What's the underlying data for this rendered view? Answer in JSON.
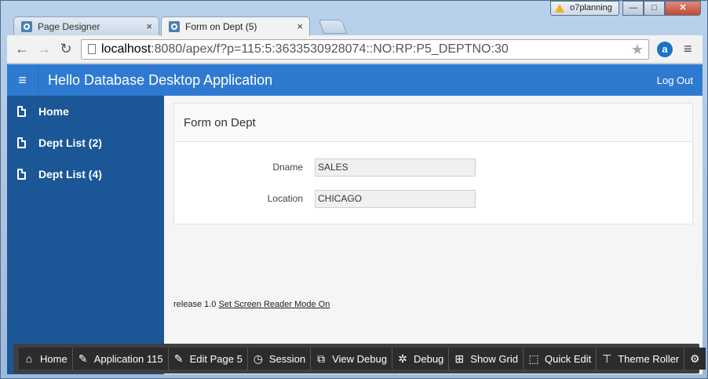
{
  "browser": {
    "tabs": [
      {
        "label": "Page Designer",
        "active": false
      },
      {
        "label": "Form on Dept (5)",
        "active": true
      }
    ],
    "tab_close_glyph": "×",
    "profile_name": "o7planning",
    "window_controls": {
      "minimize": "—",
      "maximize": "□",
      "close": "✕"
    },
    "url_host": "localhost",
    "url_rest": ":8080/apex/f?p=115:5:3633530928074::NO:RP:P5_DEPTNO:30",
    "extension_label": "a"
  },
  "app": {
    "title": "Hello Database Desktop Application",
    "logout_label": "Log Out",
    "sidebar": {
      "items": [
        {
          "label": "Home"
        },
        {
          "label": "Dept List (2)"
        },
        {
          "label": "Dept List (4)"
        }
      ]
    },
    "region": {
      "title": "Form on Dept",
      "fields": [
        {
          "label": "Dname",
          "value": "SALES"
        },
        {
          "label": "Location",
          "value": "CHICAGO"
        }
      ]
    },
    "footer": {
      "release": "release 1.0",
      "screen_reader_link": "Set Screen Reader Mode On"
    }
  },
  "dev_toolbar": {
    "buttons": [
      {
        "label": "Home",
        "icon": "home-icon"
      },
      {
        "label": "Application 115",
        "icon": "edit-icon"
      },
      {
        "label": "Edit Page 5",
        "icon": "edit-icon"
      },
      {
        "label": "Session",
        "icon": "clock-icon"
      },
      {
        "label": "View Debug",
        "icon": "open-window-icon"
      },
      {
        "label": "Debug",
        "icon": "bug-icon"
      },
      {
        "label": "Show Grid",
        "icon": "grid-icon"
      },
      {
        "label": "Quick Edit",
        "icon": "select-icon"
      },
      {
        "label": "Theme Roller",
        "icon": "paint-roller-icon"
      }
    ],
    "settings_icon": "gear-icon"
  },
  "colors": {
    "header": "#2f7ad1",
    "sidebar": "#1b5797",
    "dev_toolbar": "#3f3f3f"
  }
}
